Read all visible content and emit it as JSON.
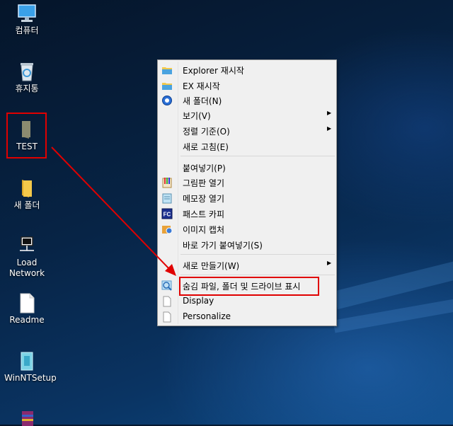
{
  "desktop": {
    "icons": [
      {
        "label": "컴퓨터",
        "icon": "computer-icon"
      },
      {
        "label": "휴지통",
        "icon": "recycle-bin-icon"
      },
      {
        "label": "TEST",
        "icon": "folder-icon"
      },
      {
        "label": "새 폴더",
        "icon": "folder-icon"
      },
      {
        "label": "Load Network",
        "icon": "network-icon"
      },
      {
        "label": "Readme",
        "icon": "document-icon"
      },
      {
        "label": "WinNTSetup",
        "icon": "setup-icon"
      },
      {
        "label": "",
        "icon": "winrar-icon"
      }
    ]
  },
  "context_menu": {
    "items": [
      {
        "label": "Explorer 재시작",
        "icon": "explorer-folder-icon"
      },
      {
        "label": "EX 재시작",
        "icon": "explorer-folder-icon"
      },
      {
        "label": "새 폴더(N)",
        "icon": "new-folder-icon"
      },
      {
        "label": "보기(V)",
        "has_submenu": true
      },
      {
        "label": "정렬 기준(O)",
        "has_submenu": true
      },
      {
        "label": "새로 고침(E)"
      },
      {
        "label": "붙여넣기(P)"
      },
      {
        "label": "그림판 열기",
        "icon": "paint-icon"
      },
      {
        "label": "메모장 열기",
        "icon": "notepad-icon"
      },
      {
        "label": "패스트 카피",
        "icon": "fastcopy-icon"
      },
      {
        "label": "이미지 캡처",
        "icon": "capture-icon"
      },
      {
        "label": "바로 가기 붙여넣기(S)"
      },
      {
        "label": "새로 만들기(W)",
        "has_submenu": true
      },
      {
        "label": "숨김 파일, 폴더 및 드라이브 표시",
        "icon": "search-icon"
      },
      {
        "label": "Display",
        "icon": "blank-page-icon"
      },
      {
        "label": "Personalize",
        "icon": "blank-page-icon"
      }
    ],
    "submenu_arrow": "▶"
  },
  "annotation": {
    "color": "#e00000"
  }
}
